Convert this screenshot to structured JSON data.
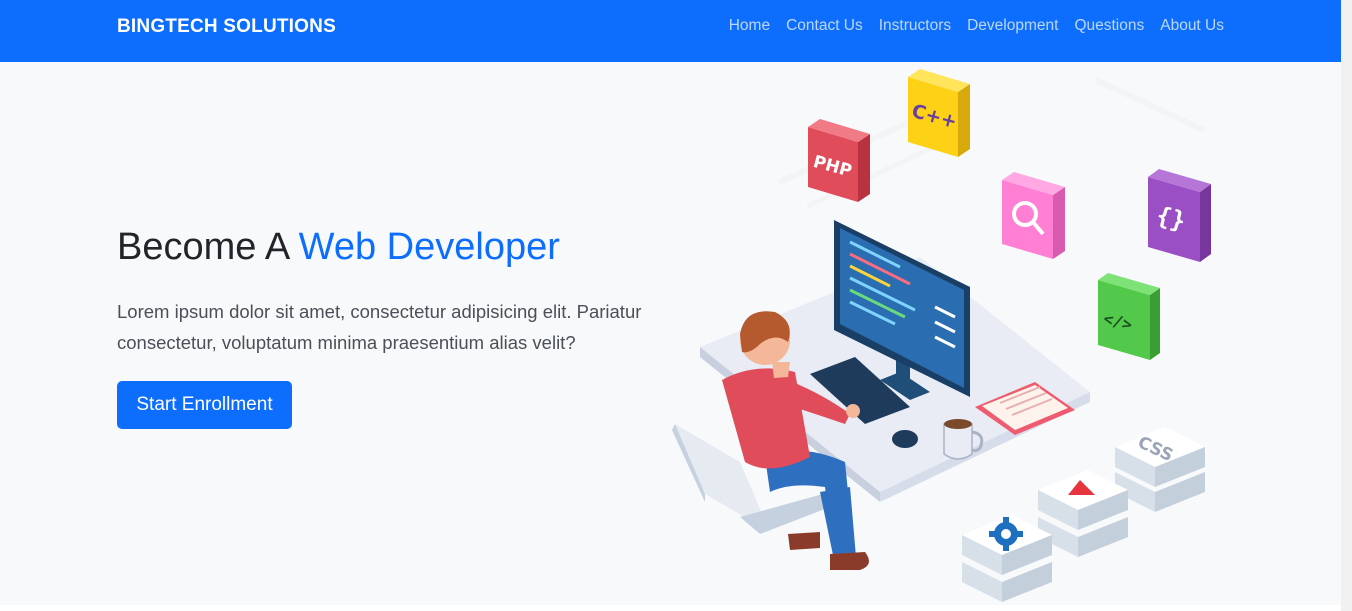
{
  "navbar": {
    "brand": "BINGTECH SOLUTIONS",
    "links": [
      "Home",
      "Contact Us",
      "Instructors",
      "Development",
      "Questions",
      "About Us"
    ]
  },
  "hero": {
    "title_prefix": "Become A ",
    "title_accent": "Web Developer",
    "description": "Lorem ipsum dolor sit amet, consectetur adipisicing elit. Pariatur consectetur, voluptatum minima praesentium alias velit?",
    "cta_label": "Start Enrollment"
  },
  "illustration": {
    "tiles": [
      "PHP",
      "C++",
      "{}",
      "</>",
      "CSS"
    ]
  },
  "colors": {
    "primary": "#0d6efd",
    "background": "#f8f9fa"
  }
}
